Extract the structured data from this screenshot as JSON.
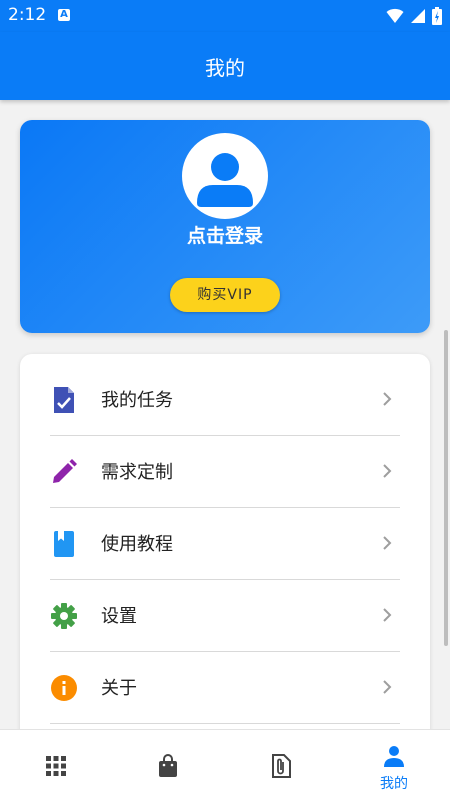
{
  "status": {
    "time": "2:12",
    "badge": "A"
  },
  "header": {
    "title": "我的"
  },
  "profile": {
    "login_text": "点击登录",
    "vip_button": "购买VIP"
  },
  "menu": {
    "items": [
      {
        "label": "我的任务",
        "icon": "task-doc-icon",
        "color": "#3f51b5"
      },
      {
        "label": "需求定制",
        "icon": "pencil-icon",
        "color": "#8e24aa"
      },
      {
        "label": "使用教程",
        "icon": "book-icon",
        "color": "#2196f3"
      },
      {
        "label": "设置",
        "icon": "gear-icon",
        "color": "#43a047"
      },
      {
        "label": "关于",
        "icon": "info-icon",
        "color": "#fb8c00"
      }
    ]
  },
  "bottom_nav": {
    "items": [
      {
        "label": "",
        "icon": "grid-icon"
      },
      {
        "label": "",
        "icon": "shopping-bag-icon"
      },
      {
        "label": "",
        "icon": "attachment-file-icon"
      },
      {
        "label": "我的",
        "icon": "person-icon",
        "active": true
      }
    ]
  },
  "colors": {
    "primary": "#0a7cf7",
    "vip": "#fcd21b",
    "inactive_icon": "#444444"
  }
}
